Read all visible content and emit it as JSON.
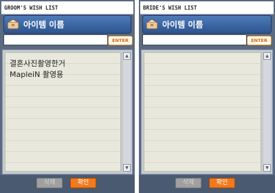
{
  "left": {
    "title": "GROOM'S WISH LIST",
    "header_label": "아이템 이름",
    "enter_label": "ENTER",
    "items": [
      "결혼사진촬영한거",
      "MapleiN 촬영용"
    ],
    "delete_label": "삭제",
    "confirm_label": "확인"
  },
  "right": {
    "title": "BRIDE'S WISH LIST",
    "header_label": "아이템 이름",
    "enter_label": "ENTER",
    "items": [],
    "delete_label": "삭제",
    "confirm_label": "확인"
  },
  "icons": {
    "header": "item-bag-icon",
    "scroll_up": "scroll-up-icon",
    "scroll_down": "scroll-down-icon"
  },
  "colors": {
    "header_blue": "#3a66a8",
    "enter_orange": "#e08a2a",
    "confirm_orange": "#f07a20"
  }
}
